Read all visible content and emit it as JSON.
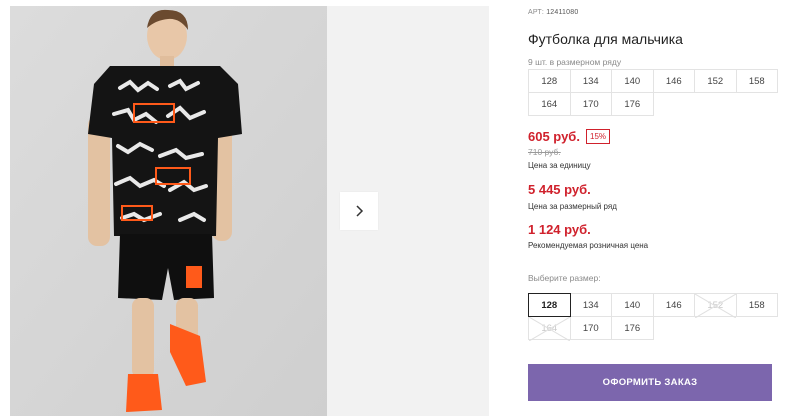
{
  "product": {
    "article_label": "АРТ:",
    "article_value": "12411080",
    "title": "Футболка для мальчика",
    "pack_note": "9 шт. в размерном ряду",
    "pack_sizes": [
      "128",
      "134",
      "140",
      "146",
      "152",
      "158",
      "164",
      "170",
      "176"
    ]
  },
  "pricing": {
    "unit_price": "605 руб.",
    "discount": "15%",
    "old_price": "710 руб.",
    "unit_caption": "Цена за единицу",
    "pack_price": "5 445 руб.",
    "pack_caption": "Цена за размерный ряд",
    "retail_price": "1 124 руб.",
    "retail_caption": "Рекомендуемая розничная цена"
  },
  "size_select": {
    "label": "Выберите размер:",
    "options": [
      {
        "label": "128",
        "state": "selected"
      },
      {
        "label": "134",
        "state": "available"
      },
      {
        "label": "140",
        "state": "available"
      },
      {
        "label": "146",
        "state": "available"
      },
      {
        "label": "152",
        "state": "unavailable"
      },
      {
        "label": "158",
        "state": "available"
      },
      {
        "label": "164",
        "state": "unavailable"
      },
      {
        "label": "170",
        "state": "available"
      },
      {
        "label": "176",
        "state": "available"
      }
    ]
  },
  "actions": {
    "order_button": "ОФОРМИТЬ ЗАКАЗ"
  },
  "gallery": {
    "next_icon": "chevron-right-icon",
    "print_words": [
      "GROW UP",
      "GREEN",
      "PINUP",
      "WALLPIN",
      "ACCURE",
      "LEADER",
      "PTD",
      "FREE"
    ]
  },
  "colors": {
    "accent_red": "#d0212c",
    "button_purple": "#7c66ad",
    "shoe_orange": "#ff5a1a"
  }
}
